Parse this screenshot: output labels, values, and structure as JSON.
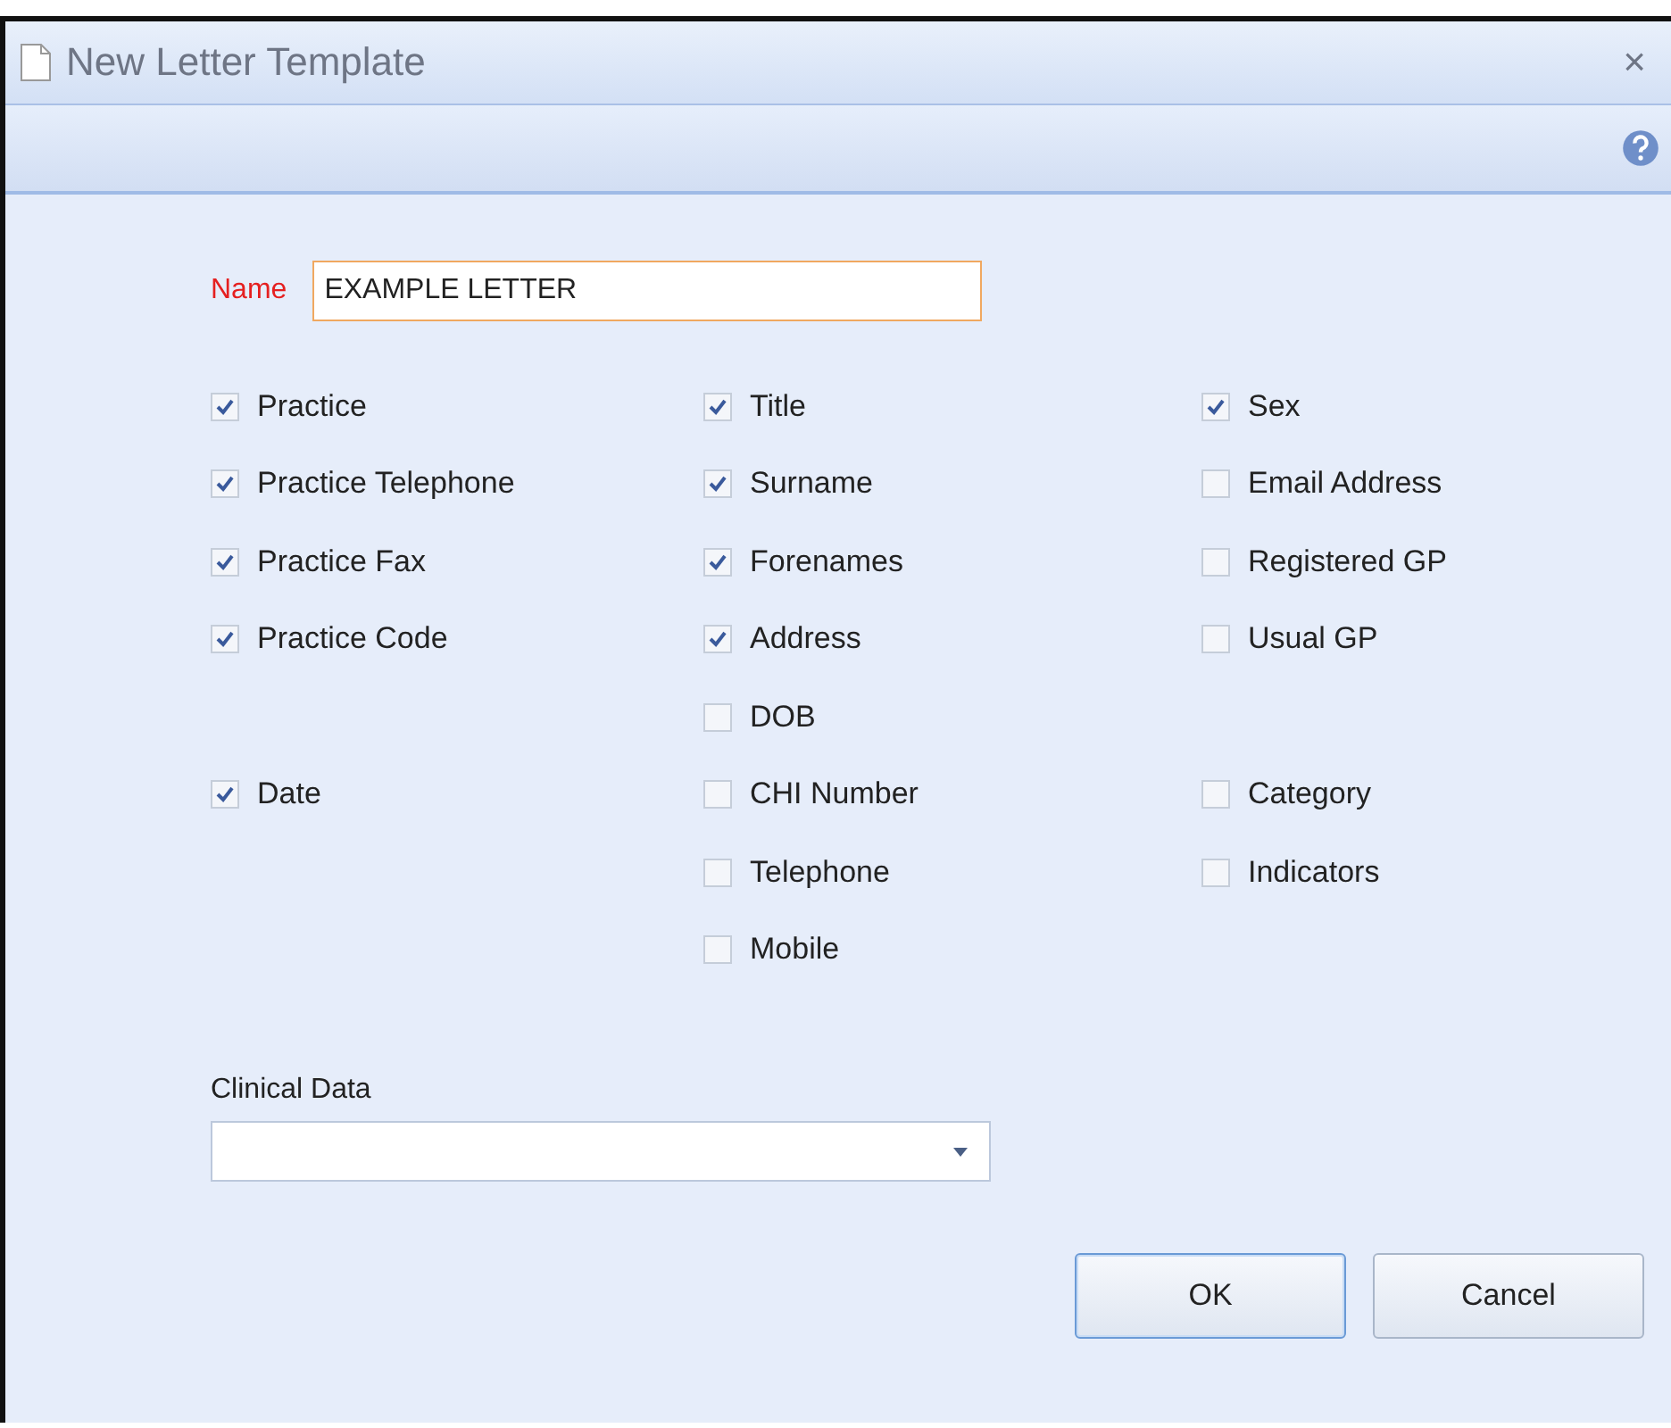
{
  "window": {
    "title": "New Letter Template",
    "close": "×"
  },
  "name_field": {
    "label": "Name",
    "value": "EXAMPLE LETTER"
  },
  "columns": [
    [
      {
        "kind": "checkbox",
        "label": "Practice",
        "checked": true
      },
      {
        "kind": "checkbox",
        "label": "Practice Telephone",
        "checked": true
      },
      {
        "kind": "checkbox",
        "label": "Practice Fax",
        "checked": true
      },
      {
        "kind": "checkbox",
        "label": "Practice Code",
        "checked": true
      },
      {
        "kind": "blank"
      },
      {
        "kind": "checkbox",
        "label": "Date",
        "checked": true
      }
    ],
    [
      {
        "kind": "checkbox",
        "label": "Title",
        "checked": true
      },
      {
        "kind": "checkbox",
        "label": "Surname",
        "checked": true
      },
      {
        "kind": "checkbox",
        "label": "Forenames",
        "checked": true
      },
      {
        "kind": "checkbox",
        "label": "Address",
        "checked": true
      },
      {
        "kind": "checkbox",
        "label": "DOB",
        "checked": false
      },
      {
        "kind": "checkbox",
        "label": "CHI Number",
        "checked": false
      },
      {
        "kind": "checkbox",
        "label": "Telephone",
        "checked": false
      },
      {
        "kind": "checkbox",
        "label": "Mobile",
        "checked": false
      }
    ],
    [
      {
        "kind": "checkbox",
        "label": "Sex",
        "checked": true
      },
      {
        "kind": "checkbox",
        "label": "Email Address",
        "checked": false
      },
      {
        "kind": "checkbox",
        "label": "Registered GP",
        "checked": false
      },
      {
        "kind": "checkbox",
        "label": "Usual GP",
        "checked": false
      },
      {
        "kind": "blank"
      },
      {
        "kind": "checkbox",
        "label": "Category",
        "checked": false
      },
      {
        "kind": "checkbox",
        "label": "Indicators",
        "checked": false
      }
    ]
  ],
  "clinical_data": {
    "label": "Clinical Data"
  },
  "buttons": [
    {
      "label": "OK",
      "default": true
    },
    {
      "label": "Cancel",
      "default": false
    }
  ]
}
